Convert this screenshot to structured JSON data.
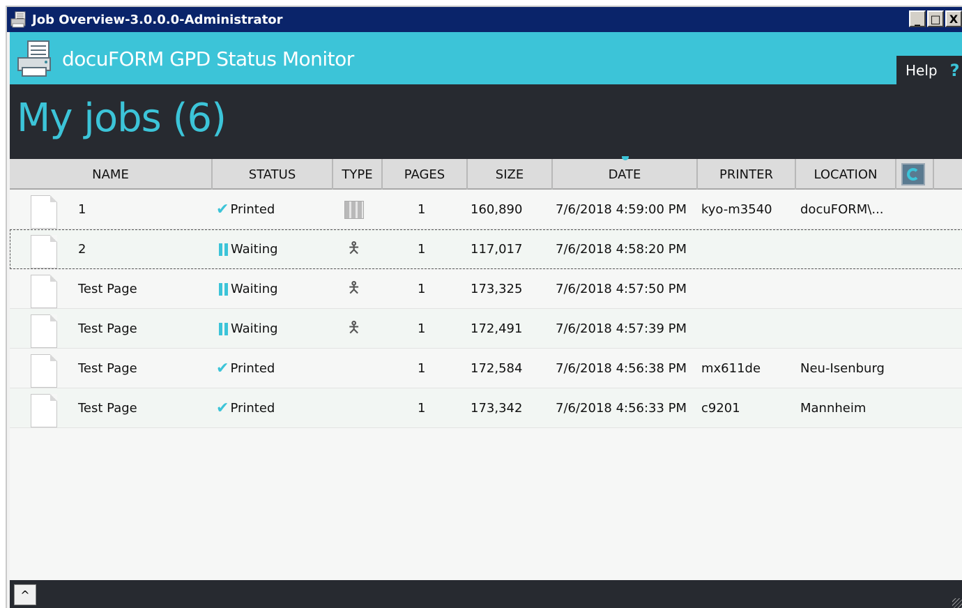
{
  "window": {
    "title": "Job Overview-3.0.0.0-Administrator",
    "controls": {
      "minimize": "_",
      "maximize": "□",
      "close": "X"
    }
  },
  "header": {
    "app_title": "docuFORM GPD Status Monitor",
    "help_label": "Help",
    "help_icon": "?"
  },
  "page": {
    "title": "My jobs (6)"
  },
  "colors": {
    "accent": "#3cc4d8",
    "dark": "#272a30",
    "titlebar": "#0a246a"
  },
  "table": {
    "columns": [
      "NAME",
      "STATUS",
      "TYPE",
      "PAGES",
      "SIZE",
      "DATE",
      "PRINTER",
      "LOCATION"
    ],
    "rows": [
      {
        "name": "1",
        "status": "Printed",
        "status_icon": "check-icon",
        "type_icon": "grid-icon",
        "pages": "1",
        "size": "160,890",
        "date": "7/6/2018 4:59:00 PM",
        "printer": "kyo-m3540",
        "location": "docuFORM\\..."
      },
      {
        "name": "2",
        "status": "Waiting",
        "status_icon": "pause-icon",
        "type_icon": "person-icon",
        "pages": "1",
        "size": "117,017",
        "date": "7/6/2018 4:58:20 PM",
        "printer": "",
        "location": ""
      },
      {
        "name": "Test Page",
        "status": "Waiting",
        "status_icon": "pause-icon",
        "type_icon": "person-icon",
        "pages": "1",
        "size": "173,325",
        "date": "7/6/2018 4:57:50 PM",
        "printer": "",
        "location": ""
      },
      {
        "name": "Test Page",
        "status": "Waiting",
        "status_icon": "pause-icon",
        "type_icon": "person-icon",
        "pages": "1",
        "size": "172,491",
        "date": "7/6/2018 4:57:39 PM",
        "printer": "",
        "location": ""
      },
      {
        "name": "Test Page",
        "status": "Printed",
        "status_icon": "check-icon",
        "type_icon": "",
        "pages": "1",
        "size": "172,584",
        "date": "7/6/2018 4:56:38 PM",
        "printer": "mx611de",
        "location": "Neu-Isenburg"
      },
      {
        "name": "Test Page",
        "status": "Printed",
        "status_icon": "check-icon",
        "type_icon": "",
        "pages": "1",
        "size": "173,342",
        "date": "7/6/2018 4:56:33 PM",
        "printer": "c9201",
        "location": "Mannheim"
      }
    ]
  },
  "footer": {
    "expand_icon": "^"
  }
}
